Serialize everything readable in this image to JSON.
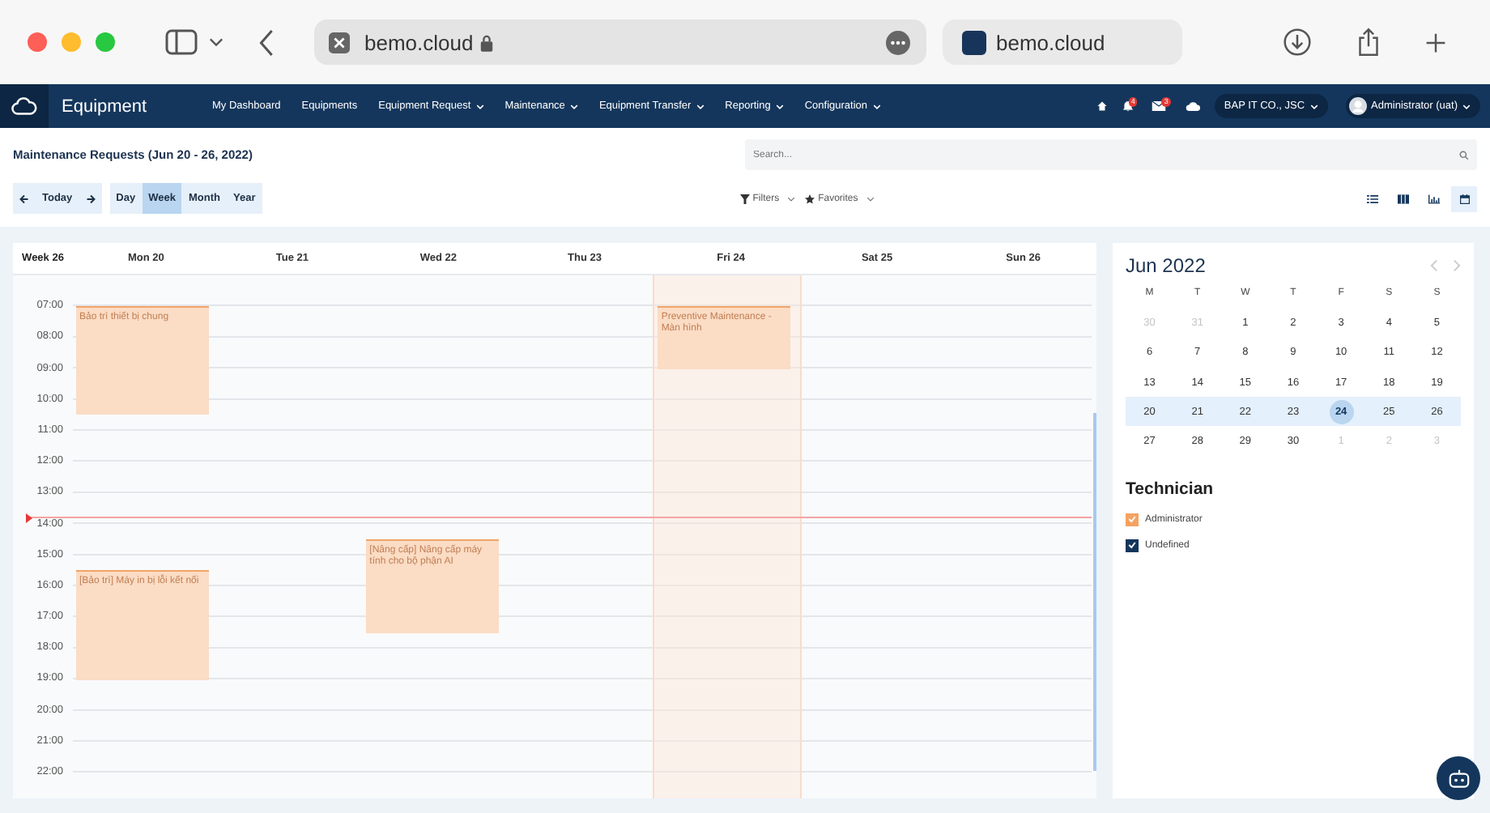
{
  "browser": {
    "address": "bemo.cloud",
    "tab_title": "bemo.cloud"
  },
  "navbar": {
    "app_title": "Equipment",
    "menu": [
      {
        "label": "My Dashboard",
        "dropdown": false
      },
      {
        "label": "Equipments",
        "dropdown": false
      },
      {
        "label": "Equipment Request",
        "dropdown": true
      },
      {
        "label": "Maintenance",
        "dropdown": true
      },
      {
        "label": "Equipment Transfer",
        "dropdown": true
      },
      {
        "label": "Reporting",
        "dropdown": true
      },
      {
        "label": "Configuration",
        "dropdown": true
      }
    ],
    "notifications_badge": "4",
    "messages_badge": "3",
    "company": "BAP IT CO., JSC",
    "user": "Administrator (uat)"
  },
  "page_title": "Maintenance Requests (Jun 20 - 26, 2022)",
  "search": {
    "placeholder": "Search..."
  },
  "today_button": "Today",
  "scales": [
    {
      "label": "Day",
      "selected": false
    },
    {
      "label": "Week",
      "selected": true
    },
    {
      "label": "Month",
      "selected": false
    },
    {
      "label": "Year",
      "selected": false
    }
  ],
  "filters": "Filters",
  "favorites": "Favorites",
  "views": [
    {
      "kind": "list",
      "selected": false
    },
    {
      "kind": "kanban",
      "selected": false
    },
    {
      "kind": "graph",
      "selected": false
    },
    {
      "kind": "calendar",
      "selected": true
    }
  ],
  "calendar": {
    "week_label": "Week 26",
    "hours": [
      "07:00",
      "08:00",
      "09:00",
      "10:00",
      "11:00",
      "12:00",
      "13:00",
      "14:00",
      "15:00",
      "16:00",
      "17:00",
      "18:00",
      "19:00",
      "20:00",
      "21:00",
      "22:00"
    ],
    "days": [
      {
        "label": "Mon 20",
        "today": false,
        "events": [
          {
            "title": "Bảo trì thiết bị chung"
          },
          {
            "title": "[Bảo trì] Máy in bị lỗi kết nối"
          }
        ]
      },
      {
        "label": "Tue 21",
        "today": false
      },
      {
        "label": "Wed 22",
        "today": false,
        "events": [
          {
            "title": "[Nâng cấp] Nâng cấp máy tính cho bộ phận AI"
          }
        ]
      },
      {
        "label": "Thu 23",
        "today": false
      },
      {
        "label": "Fri 24",
        "today": true,
        "events": [
          {
            "title": "Preventive Maintenance - Màn hình"
          }
        ]
      },
      {
        "label": "Sat 25",
        "today": false
      },
      {
        "label": "Sun 26",
        "today": false
      }
    ]
  },
  "mini_calendar": {
    "title": "Jun 2022",
    "weekdays": [
      "M",
      "T",
      "W",
      "T",
      "F",
      "S",
      "S"
    ],
    "weeks": [
      {
        "current": false,
        "days": [
          {
            "d": "30",
            "muted": true,
            "selected": false
          },
          {
            "d": "31",
            "muted": true,
            "selected": false
          },
          {
            "d": "1",
            "muted": false,
            "selected": false
          },
          {
            "d": "2",
            "muted": false,
            "selected": false
          },
          {
            "d": "3",
            "muted": false,
            "selected": false
          },
          {
            "d": "4",
            "muted": false,
            "selected": false
          },
          {
            "d": "5",
            "muted": false,
            "selected": false
          }
        ]
      },
      {
        "current": false,
        "days": [
          {
            "d": "6",
            "muted": false,
            "selected": false
          },
          {
            "d": "7",
            "muted": false,
            "selected": false
          },
          {
            "d": "8",
            "muted": false,
            "selected": false
          },
          {
            "d": "9",
            "muted": false,
            "selected": false
          },
          {
            "d": "10",
            "muted": false,
            "selected": false
          },
          {
            "d": "11",
            "muted": false,
            "selected": false
          },
          {
            "d": "12",
            "muted": false,
            "selected": false
          }
        ]
      },
      {
        "current": false,
        "days": [
          {
            "d": "13",
            "muted": false,
            "selected": false
          },
          {
            "d": "14",
            "muted": false,
            "selected": false
          },
          {
            "d": "15",
            "muted": false,
            "selected": false
          },
          {
            "d": "16",
            "muted": false,
            "selected": false
          },
          {
            "d": "17",
            "muted": false,
            "selected": false
          },
          {
            "d": "18",
            "muted": false,
            "selected": false
          },
          {
            "d": "19",
            "muted": false,
            "selected": false
          }
        ]
      },
      {
        "current": true,
        "days": [
          {
            "d": "20",
            "muted": false,
            "selected": false
          },
          {
            "d": "21",
            "muted": false,
            "selected": false
          },
          {
            "d": "22",
            "muted": false,
            "selected": false
          },
          {
            "d": "23",
            "muted": false,
            "selected": false
          },
          {
            "d": "24",
            "muted": false,
            "selected": true
          },
          {
            "d": "25",
            "muted": false,
            "selected": false
          },
          {
            "d": "26",
            "muted": false,
            "selected": false
          }
        ]
      },
      {
        "current": false,
        "days": [
          {
            "d": "27",
            "muted": false,
            "selected": false
          },
          {
            "d": "28",
            "muted": false,
            "selected": false
          },
          {
            "d": "29",
            "muted": false,
            "selected": false
          },
          {
            "d": "30",
            "muted": false,
            "selected": false
          },
          {
            "d": "1",
            "muted": true,
            "selected": false
          },
          {
            "d": "2",
            "muted": true,
            "selected": false
          },
          {
            "d": "3",
            "muted": true,
            "selected": false
          }
        ]
      }
    ]
  },
  "technician": {
    "title": "Technician",
    "items": [
      {
        "name": "Administrator",
        "checked": true,
        "color": "#f4a261"
      },
      {
        "name": "Undefined",
        "checked": true,
        "color": "#14365c"
      }
    ]
  }
}
